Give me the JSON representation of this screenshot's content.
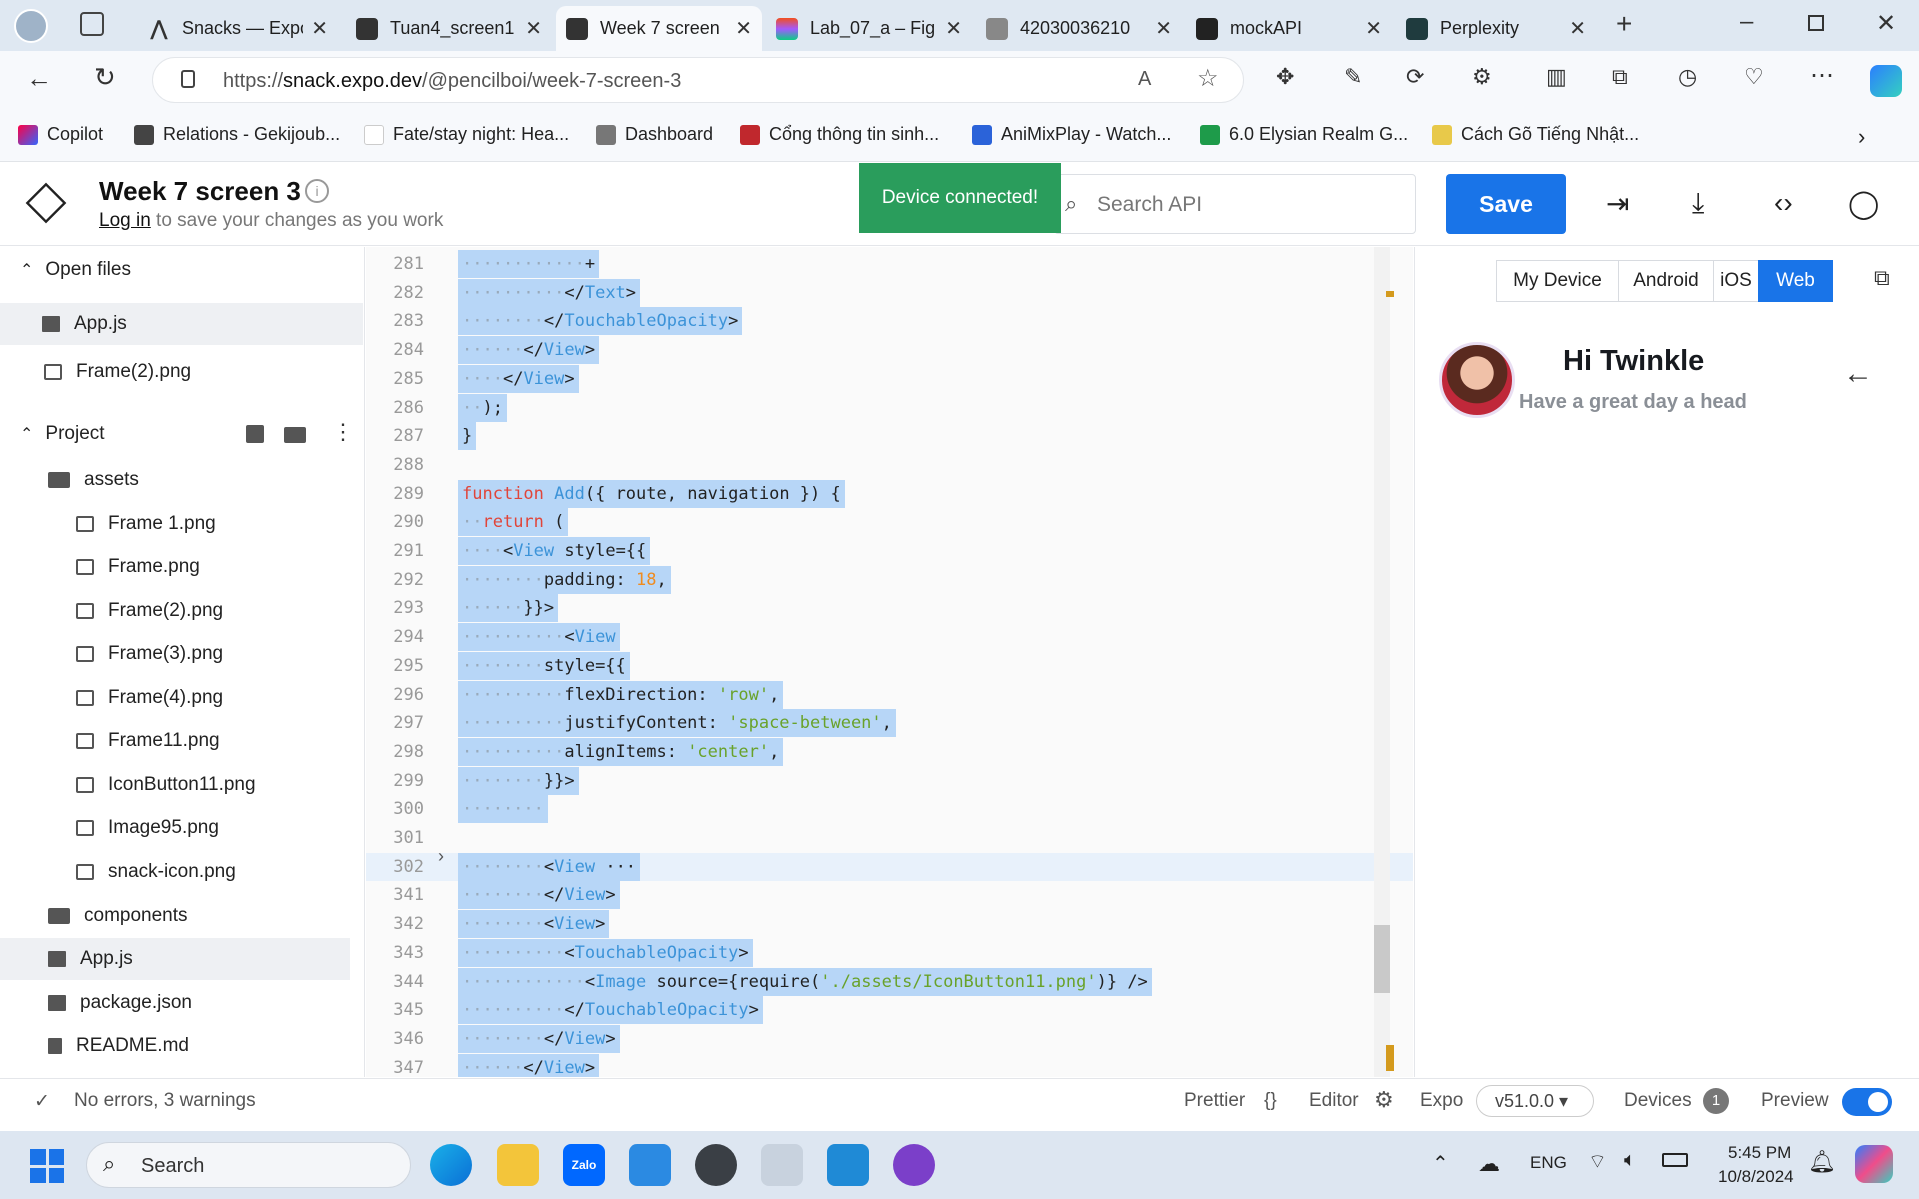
{
  "browser": {
    "tabs": [
      {
        "title": "Snacks — Expo",
        "icon": "expo-icon"
      },
      {
        "title": "Tuan4_screen1",
        "icon": "snack-icon"
      },
      {
        "title": "Week 7 screen",
        "icon": "snack-icon",
        "active": true
      },
      {
        "title": "Lab_07_a – Fig",
        "icon": "figma-icon"
      },
      {
        "title": "42030036210",
        "icon": "document-icon"
      },
      {
        "title": "mockAPI",
        "icon": "mockapi-icon"
      },
      {
        "title": "Perplexity",
        "icon": "perplexity-icon"
      }
    ],
    "url_prefix": "https://",
    "url_host": "snack.expo.dev",
    "url_path": "/@pencilboi/week-7-screen-3",
    "bookmarks": [
      "Copilot",
      "Relations - Gekijoub...",
      "Fate/stay night: Hea...",
      "Dashboard",
      "Cổng thông tin sinh...",
      "AniMixPlay - Watch...",
      "6.0 Elysian Realm G...",
      "Cách Gõ Tiếng Nhật..."
    ]
  },
  "snack": {
    "title": "Week 7 screen 3",
    "login_link": "Log in",
    "login_hint": " to save your changes as you work",
    "toast": "Device connected!",
    "search_placeholder": "Search API",
    "save_label": "Save"
  },
  "sidebar": {
    "open_files_label": "Open files",
    "open_files": [
      "App.js",
      "Frame(2).png"
    ],
    "project_label": "Project",
    "folders": {
      "assets": "assets",
      "components": "components"
    },
    "assets_files": [
      "Frame 1.png",
      "Frame.png",
      "Frame(2).png",
      "Frame(3).png",
      "Frame(4).png",
      "Frame11.png",
      "IconButton11.png",
      "Image95.png",
      "snack-icon.png"
    ],
    "root_files": [
      "App.js",
      "package.json",
      "README.md"
    ]
  },
  "editor": {
    "lines": [
      {
        "n": "281",
        "text": "+"
      },
      {
        "n": "282",
        "text": "</Text>"
      },
      {
        "n": "283",
        "text": "</TouchableOpacity>"
      },
      {
        "n": "284",
        "text": "</View>"
      },
      {
        "n": "285",
        "text": "</View>"
      },
      {
        "n": "286",
        "text": ");"
      },
      {
        "n": "287",
        "text": "}"
      },
      {
        "n": "288",
        "text": ""
      },
      {
        "n": "289",
        "text": "function Add({ route, navigation }) {"
      },
      {
        "n": "290",
        "text": "return ("
      },
      {
        "n": "291",
        "text": "<View style={{"
      },
      {
        "n": "292",
        "text": "padding: 18,"
      },
      {
        "n": "293",
        "text": "}}>"
      },
      {
        "n": "294",
        "text": "<View"
      },
      {
        "n": "295",
        "text": "style={{"
      },
      {
        "n": "296",
        "text": "flexDirection: 'row',"
      },
      {
        "n": "297",
        "text": "justifyContent: 'space-between',"
      },
      {
        "n": "298",
        "text": "alignItems: 'center',"
      },
      {
        "n": "299",
        "text": "}}>"
      },
      {
        "n": "300",
        "text": ""
      },
      {
        "n": "301",
        "text": ""
      },
      {
        "n": "302",
        "text": "<View ···"
      },
      {
        "n": "341",
        "text": "</View>"
      },
      {
        "n": "342",
        "text": "<View>"
      },
      {
        "n": "343",
        "text": "<TouchableOpacity>"
      },
      {
        "n": "344",
        "text": "<Image source={require('./assets/IconButton11.png')} />"
      },
      {
        "n": "345",
        "text": "</TouchableOpacity>"
      },
      {
        "n": "346",
        "text": "</View>"
      },
      {
        "n": "347",
        "text": "</View>"
      }
    ]
  },
  "preview": {
    "tabs": [
      "My Device",
      "Android",
      "iOS",
      "Web"
    ],
    "active_tab": "Web",
    "greeting": "Hi Twinkle",
    "subgreeting": "Have a great day a head"
  },
  "status": {
    "errors": "No errors, 3 warnings",
    "prettier": "Prettier",
    "editor": "Editor",
    "expo": "Expo",
    "version": "v51.0.0",
    "devices": "Devices",
    "devices_count": "1",
    "preview": "Preview"
  },
  "taskbar": {
    "search_placeholder": "Search",
    "language": "ENG",
    "time": "5:45 PM",
    "date": "10/8/2024"
  },
  "colors": {
    "accent": "#1974e8",
    "toast": "#2a9d5c",
    "selection": "#b7d6f7"
  }
}
